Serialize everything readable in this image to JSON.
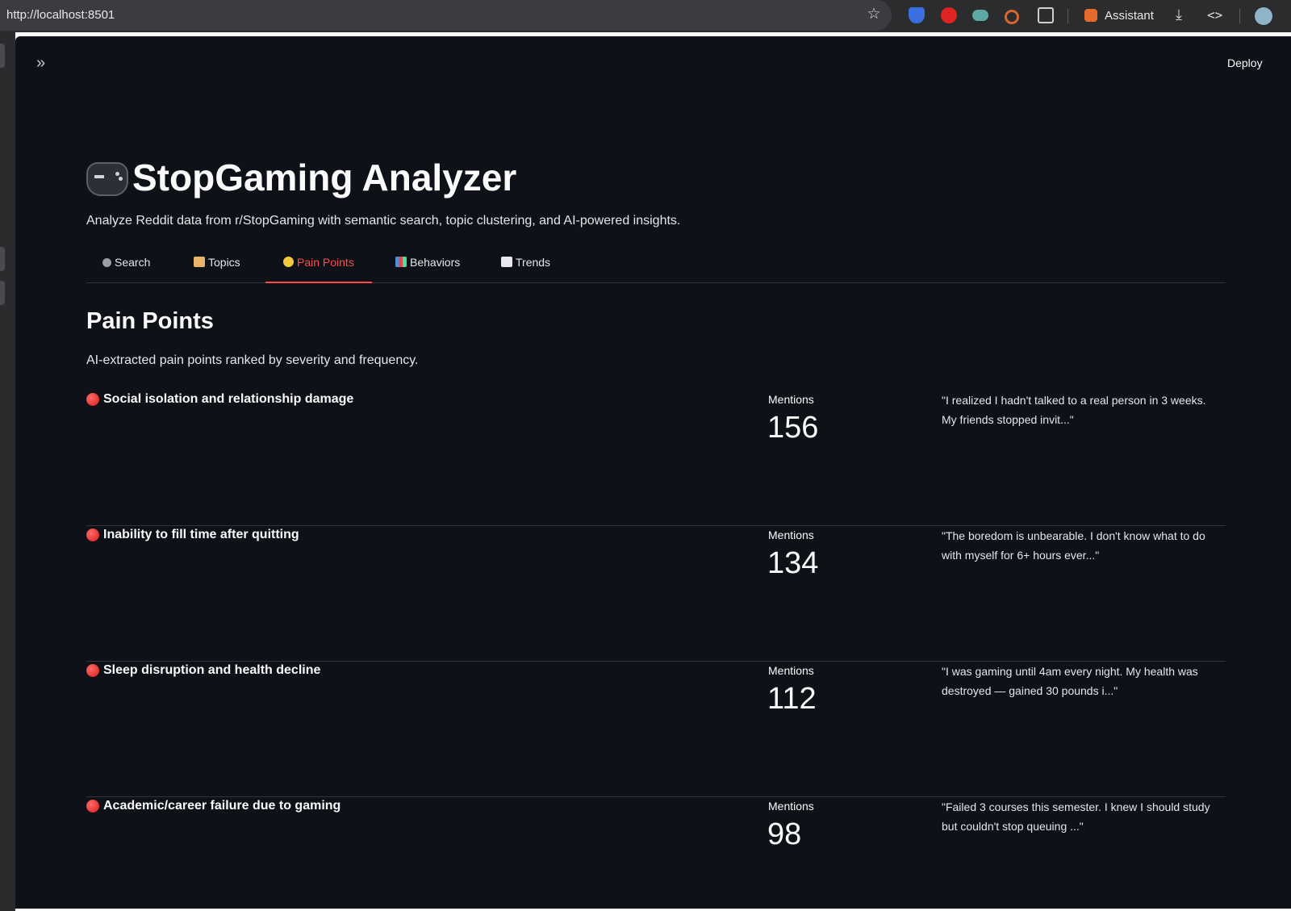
{
  "browser": {
    "url": "http://localhost:8501",
    "assistant_label": "Assistant"
  },
  "header": {
    "deploy_label": "Deploy"
  },
  "app": {
    "title": "StopGaming Analyzer",
    "subtitle": "Analyze Reddit data from r/StopGaming with semantic search, topic clustering, and AI-powered insights."
  },
  "tabs": [
    {
      "label": "Search",
      "icon": "magnifier-icon",
      "active": false
    },
    {
      "label": "Topics",
      "icon": "folder-icon",
      "active": false
    },
    {
      "label": "Pain Points",
      "icon": "face-icon",
      "active": true
    },
    {
      "label": "Behaviors",
      "icon": "bar-chart-icon",
      "active": false
    },
    {
      "label": "Trends",
      "icon": "trend-chart-icon",
      "active": false
    }
  ],
  "section": {
    "title": "Pain Points",
    "description": "AI-extracted pain points ranked by severity and frequency."
  },
  "pain_points": [
    {
      "title": "Social isolation and relationship damage",
      "metric_label": "Mentions",
      "mentions": "156",
      "quote": "\"I realized I hadn't talked to a real person in 3 weeks. My friends stopped invit...\""
    },
    {
      "title": "Inability to fill time after quitting",
      "metric_label": "Mentions",
      "mentions": "134",
      "quote": "\"The boredom is unbearable. I don't know what to do with myself for 6+ hours ever...\""
    },
    {
      "title": "Sleep disruption and health decline",
      "metric_label": "Mentions",
      "mentions": "112",
      "quote": "\"I was gaming until 4am every night. My health was destroyed — gained 30 pounds i...\""
    },
    {
      "title": "Academic/career failure due to gaming",
      "metric_label": "Mentions",
      "mentions": "98",
      "quote": "\"Failed 3 courses this semester. I knew I should study but couldn't stop queuing ...\""
    }
  ],
  "colors": {
    "background": "#0e1117",
    "accent": "#ff4b4b",
    "severity_dot": "#e02424"
  }
}
